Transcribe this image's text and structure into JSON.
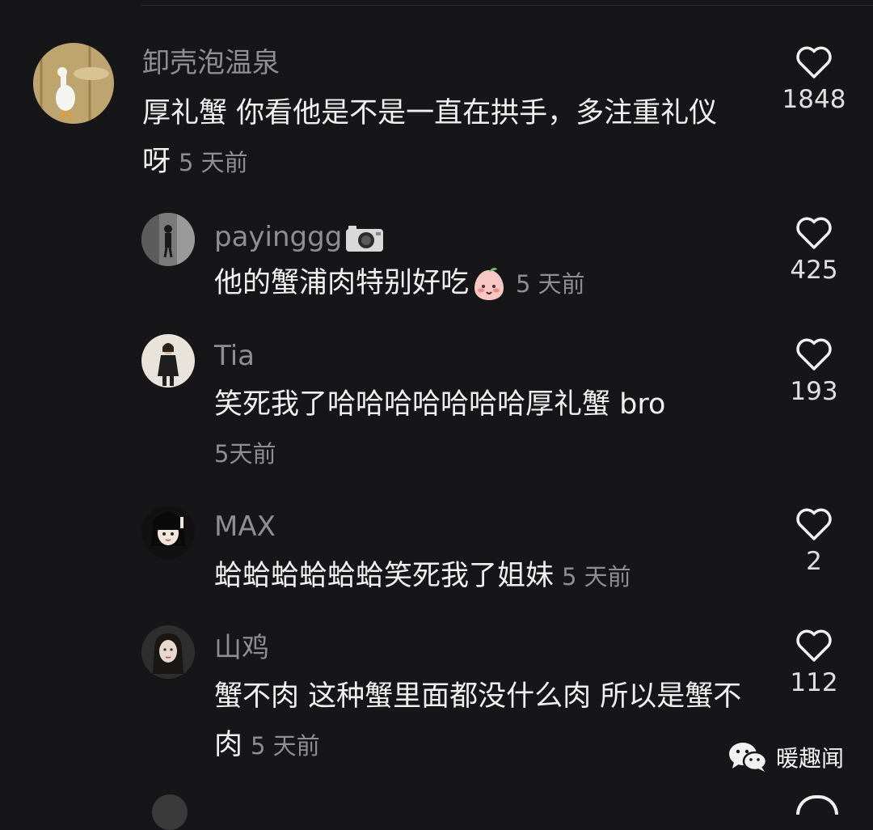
{
  "comments": [
    {
      "user": "卸壳泡温泉",
      "text": "厚礼蟹 你看他是不是一直在拱手，多注重礼仪呀",
      "time": "5 天前",
      "likes": "1848"
    },
    {
      "user": "payinggg",
      "text": "他的蟹浦肉特别好吃",
      "time": "5 天前",
      "likes": "425",
      "user_icon": "camera-icon",
      "emoji": "shy-peach-emoji"
    },
    {
      "user": "Tia",
      "text": "笑死我了哈哈哈哈哈哈哈厚礼蟹 bro",
      "time": "5天前",
      "likes": "193"
    },
    {
      "user": "MAX",
      "text": "蛤蛤蛤蛤蛤蛤笑死我了姐妹",
      "time": "5 天前",
      "likes": "2"
    },
    {
      "user": "山鸡",
      "text": "蟹不肉 这种蟹里面都没什么肉 所以是蟹不肉",
      "time": "5 天前",
      "likes": "112"
    }
  ],
  "watermark": {
    "label": "暖趣闻",
    "icon": "wechat-icon"
  },
  "colors": {
    "background": "#161618",
    "username": "#8e8e93",
    "text": "#f0f0f0",
    "heart": "#f0f0f0"
  }
}
